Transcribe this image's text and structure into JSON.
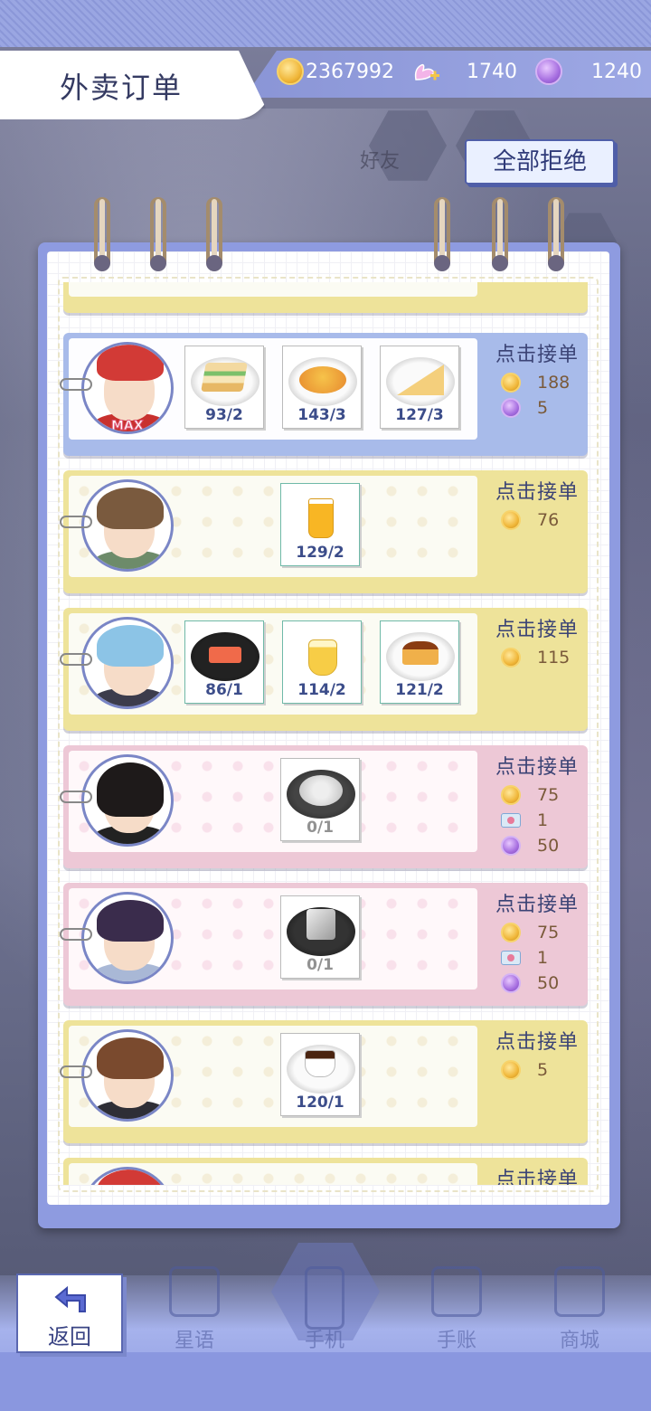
{
  "header": {
    "title": "外卖订单",
    "coins": "2367992",
    "swan_points": "1740",
    "gems": "1240"
  },
  "reject_all_label": "全部拒绝",
  "accept_label": "点击接单",
  "orders": [
    {
      "style": "blue",
      "avatar_tag": "MAX",
      "items": [
        {
          "icon": "sandwich-icon",
          "count": "93/2"
        },
        {
          "icon": "omelette-icon",
          "count": "143/3"
        },
        {
          "icon": "pie-slice-icon",
          "count": "127/3"
        }
      ],
      "rewards": [
        {
          "icon": "coin-icon",
          "value": "188"
        },
        {
          "icon": "gem-icon",
          "value": "5"
        }
      ]
    },
    {
      "style": "yellow",
      "items": [
        {
          "icon": "juice-glass-icon",
          "count": "129/2"
        }
      ],
      "rewards": [
        {
          "icon": "coin-icon",
          "value": "76"
        }
      ]
    },
    {
      "style": "yellow",
      "items": [
        {
          "icon": "sushi-icon",
          "count": "86/1"
        },
        {
          "icon": "pudding-cup-icon",
          "count": "114/2"
        },
        {
          "icon": "flan-icon",
          "count": "121/2"
        }
      ],
      "rewards": [
        {
          "icon": "coin-icon",
          "value": "115"
        }
      ]
    },
    {
      "style": "pink",
      "items": [
        {
          "icon": "rice-plate-icon",
          "count": "0/1"
        }
      ],
      "rewards": [
        {
          "icon": "coin-icon",
          "value": "75"
        },
        {
          "icon": "ticket-icon",
          "value": "1"
        },
        {
          "icon": "gem-icon",
          "value": "50"
        }
      ]
    },
    {
      "style": "pink",
      "items": [
        {
          "icon": "cube-cake-icon",
          "count": "0/1"
        }
      ],
      "rewards": [
        {
          "icon": "coin-icon",
          "value": "75"
        },
        {
          "icon": "ticket-icon",
          "value": "1"
        },
        {
          "icon": "gem-icon",
          "value": "50"
        }
      ]
    },
    {
      "style": "yellow",
      "items": [
        {
          "icon": "coffee-cup-icon",
          "count": "120/1"
        }
      ],
      "rewards": [
        {
          "icon": "coin-icon",
          "value": "5"
        }
      ]
    }
  ],
  "partial_order_label": "点击接单",
  "background_labels": {
    "friends": "好友"
  },
  "nav": {
    "back": "返回",
    "star": "星语",
    "phone": "手机",
    "journal": "手账",
    "shop": "商城"
  }
}
